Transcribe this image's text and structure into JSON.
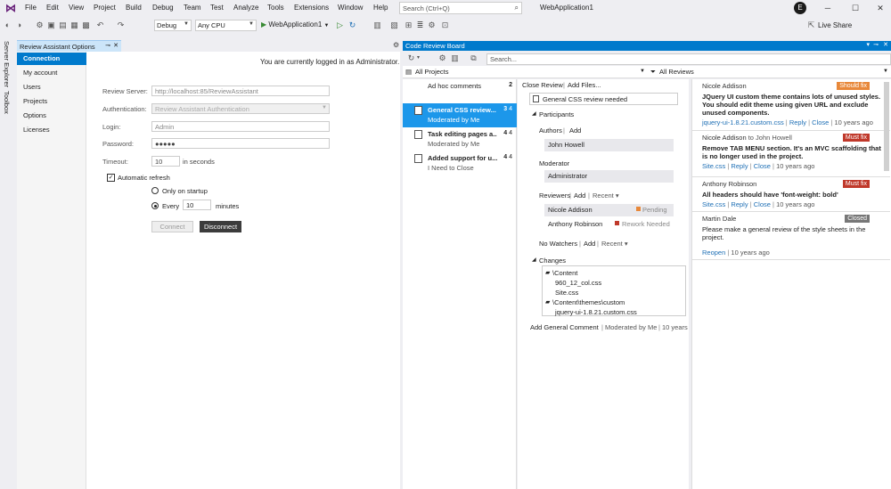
{
  "menu": [
    "File",
    "Edit",
    "View",
    "Project",
    "Build",
    "Debug",
    "Team",
    "Test",
    "Analyze",
    "Tools",
    "Extensions",
    "Window",
    "Help"
  ],
  "search": {
    "placeholder": "Search (Ctrl+Q)"
  },
  "solution_name": "WebApplication1",
  "user_initial": "E",
  "toolbar": {
    "config": "Debug",
    "platform": "Any CPU",
    "run_target": "WebApplication1",
    "live_share": "Live Share"
  },
  "side_tabs": [
    "Server Explorer",
    "Toolbox"
  ],
  "left_panel": {
    "tab_title": "Review Assistant Options",
    "nav": [
      "Connection",
      "My account",
      "Users",
      "Projects",
      "Options",
      "Licenses"
    ],
    "logged_msg": "You are currently logged in as Administrator.",
    "fields": {
      "review_server_label": "Review Server:",
      "review_server_value": "http://localhost:85/ReviewAssistant",
      "auth_label": "Authentication:",
      "auth_value": "Review Assistant Authentication",
      "login_label": "Login:",
      "login_value": "Admin",
      "password_label": "Password:",
      "password_value": "●●●●●",
      "timeout_label": "Timeout:",
      "timeout_value": "10",
      "timeout_unit": "in seconds",
      "auto_refresh_label": "Automatic refresh",
      "only_startup_label": "Only on startup",
      "every_label": "Every",
      "every_value": "10",
      "every_unit": "minutes"
    },
    "connect_button": "Connect",
    "disconnect_button": "Disconnect"
  },
  "review_board": {
    "title": "Code Review Board",
    "search_placeholder": "Search...",
    "filter_projects": "All Projects",
    "filter_reviews": "All Reviews",
    "reviews": [
      {
        "title": "Ad hoc comments",
        "subtitle": "",
        "count": "2",
        "count2": ""
      },
      {
        "title": "General CSS review...",
        "subtitle": "Moderated by Me",
        "count": "3",
        "count2": "4"
      },
      {
        "title": "Task editing pages a...",
        "subtitle": "Moderated by Me",
        "count": "4",
        "count2": "4"
      },
      {
        "title": "Added support for u...",
        "subtitle": "I Need to Close",
        "count": "4",
        "count2": "4"
      }
    ],
    "detail": {
      "close_review": "Close Review",
      "add_files": "Add Files...",
      "review_title": "General CSS review needed",
      "participants": "Participants",
      "authors_label": "Authors",
      "add": "Add",
      "author": "John Howell",
      "moderator_label": "Moderator",
      "moderator": "Administrator",
      "reviewers_label": "Reviewers",
      "recent": "Recent ▾",
      "reviewers": [
        {
          "name": "Nicole Addison",
          "status": "Pending",
          "color": "#e8883a"
        },
        {
          "name": "Anthony Robinson",
          "status": "Rework Needed",
          "color": "#c0392b"
        }
      ],
      "watchers_label": "No Watchers",
      "changes_label": "Changes",
      "changes": [
        "\\Content",
        "960_12_col.css",
        "Site.css",
        "\\Content\\themes\\custom",
        "jquery-ui-1.8.21.custom.css"
      ],
      "add_general_comment": "Add General Comment",
      "moderated_by": "Moderated by Me",
      "age": "10 years"
    },
    "comments": [
      {
        "author": "Nicole Addison",
        "to": "",
        "badge": "Should fix",
        "badge_color": "#e8883a",
        "body": "JQuery UI custom theme contains lots of unused styles. You should edit theme using given URL and exclude unused components.",
        "file": "jquery-ui-1.8.21.custom.css",
        "reply": "Reply",
        "close": "Close",
        "age": "10 years ago"
      },
      {
        "author": "Nicole Addison",
        "to": "to John Howell",
        "badge": "Must fix",
        "badge_color": "#c0392b",
        "body": "Remove TAB MENU section. It's an MVC scaffolding that is no longer used in the project.",
        "file": "Site.css",
        "reply": "Reply",
        "close": "Close",
        "age": "10 years ago"
      },
      {
        "author": "Anthony Robinson",
        "to": "",
        "badge": "Must fix",
        "badge_color": "#c0392b",
        "body": "All headers should have 'font-weight: bold'",
        "file": "Site.css",
        "reply": "Reply",
        "close": "Close",
        "age": "10 years ago"
      },
      {
        "author": "Martin Dale",
        "to": "",
        "badge": "Closed",
        "badge_color": "#777777",
        "body": "Please make a general review of the style sheets in the project.",
        "file": "",
        "reply": "Reopen",
        "close": "",
        "age": "10 years ago"
      }
    ]
  }
}
